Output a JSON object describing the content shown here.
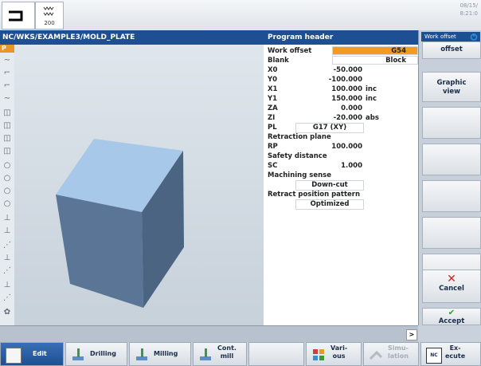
{
  "topbar": {
    "clock_line1": "08/15/",
    "clock_line2": "8:21:0"
  },
  "path": "NC/WKS/EXAMPLE3/MOLD_PLATE",
  "header_title": "Program header",
  "iconcol": {
    "p_label": "P"
  },
  "params": {
    "work_offset_label": "Work offset",
    "work_offset_value": "G54",
    "blank_label": "Blank",
    "blank_value": "Block",
    "x0_label": "X0",
    "x0_value": "-50.000",
    "y0_label": "Y0",
    "y0_value": "-100.000",
    "x1_label": "X1",
    "x1_value": "100.000",
    "x1_unit": "inc",
    "y1_label": "Y1",
    "y1_value": "150.000",
    "y1_unit": "inc",
    "za_label": "ZA",
    "za_value": "0.000",
    "zi_label": "ZI",
    "zi_value": "-20.000",
    "zi_unit": "abs",
    "pl_label": "PL",
    "pl_value": "G17 (XY)",
    "retraction_plane_label": "Retraction plane",
    "rp_label": "RP",
    "rp_value": "100.000",
    "safety_distance_label": "Safety distance",
    "sc_label": "SC",
    "sc_value": "1.000",
    "machining_sense_label": "Machining sense",
    "machining_sense_value": "Down-cut",
    "retract_pattern_label": "Retract position pattern",
    "retract_pattern_value": "Optimized"
  },
  "softkeys": {
    "work_offset_badge": "Work offset",
    "offset_label": "offset",
    "graphic_view_line1": "Graphic",
    "graphic_view_line2": "view",
    "cancel_label": "Cancel",
    "accept_label": "Accept"
  },
  "bottom": {
    "edit": "Edit",
    "drilling": "Drilling",
    "milling": "Milling",
    "cont_mill_line1": "Cont.",
    "cont_mill_line2": "mill",
    "various_line1": "Vari-",
    "various_line2": "ous",
    "simulation_line1": "Simu-",
    "simulation_line2": "lation",
    "execute_line1": "Ex-",
    "execute_line2": "ecute",
    "execute_badge": "NC"
  },
  "colors": {
    "accent_blue": "#1e4f92",
    "orange": "#f39a21",
    "block_top": "#a7c8e8",
    "block_front": "#5a7595"
  }
}
